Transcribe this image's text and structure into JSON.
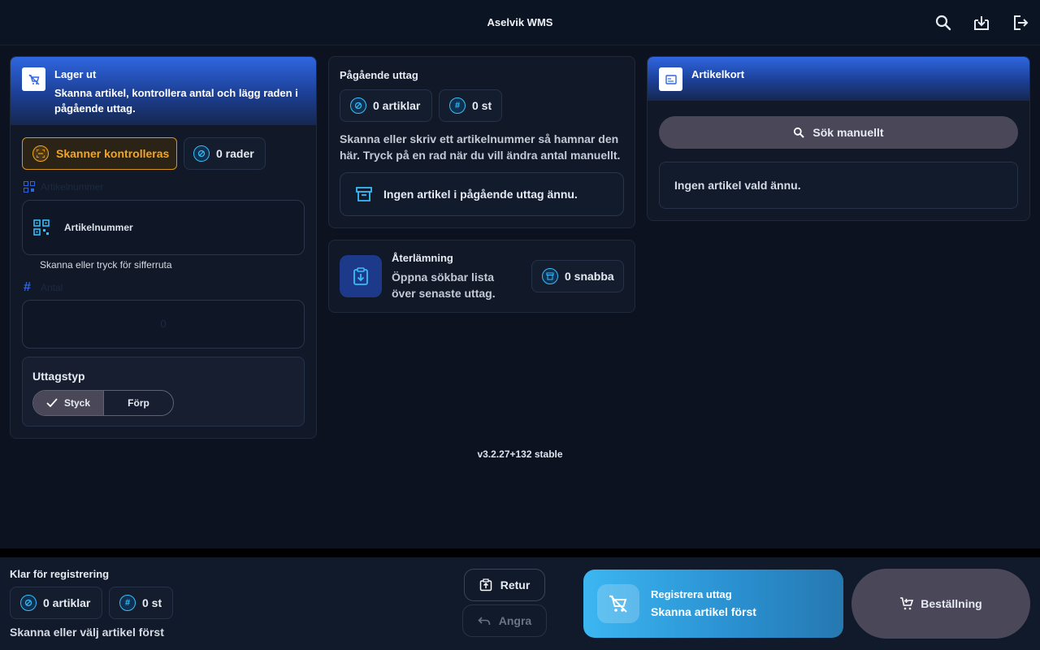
{
  "app": {
    "title": "Aselvik WMS"
  },
  "topbar": {
    "icons": [
      "search-icon",
      "download-icon",
      "logout-icon"
    ]
  },
  "lager_ut": {
    "title": "Lager ut",
    "description": "Skanna artikel, kontrollera antal och lägg raden i pågående uttag.",
    "scanner_status": "Skanner kontrolleras",
    "rows_count": "0 rader",
    "artikel_label": "Artikelnummer",
    "artikel_placeholder": "Artikelnummer",
    "artikel_helper": "Skanna eller tryck för sifferruta",
    "antal_label": "Antal",
    "antal_value": "0",
    "uttagstyp_title": "Uttagstyp",
    "uttagstyp_options": [
      "Styck",
      "Förp"
    ],
    "uttagstyp_selected": "Styck"
  },
  "pagaende": {
    "title": "Pågående uttag",
    "articles": "0 artiklar",
    "pieces": "0 st",
    "description": "Skanna eller skriv ett artikelnummer så hamnar den här. Tryck på en rad när du vill ändra antal manuellt.",
    "empty_text": "Ingen artikel i pågående uttag ännu."
  },
  "aterlamning": {
    "title": "Återlämning",
    "description": "Öppna sökbar lista över senaste uttag.",
    "quick_count": "0 snabba"
  },
  "artikelkort": {
    "title": "Artikelkort",
    "search_button": "Sök manuellt",
    "empty_text": "Ingen artikel vald ännu."
  },
  "version": "v3.2.27+132 stable",
  "bottom": {
    "status_title": "Klar för registrering",
    "articles": "0 artiklar",
    "pieces": "0 st",
    "hint": "Skanna eller välj artikel först",
    "retur_label": "Retur",
    "angra_label": "Angra",
    "register_title": "Registrera uttag",
    "register_subtitle": "Skanna artikel först",
    "bestallning_label": "Beställning"
  },
  "colors": {
    "accent_blue": "#2f66e0",
    "scanner_orange": "#f5a524",
    "chip_cyan": "#38bdf8",
    "register_gradient_start": "#3cb6f1"
  }
}
